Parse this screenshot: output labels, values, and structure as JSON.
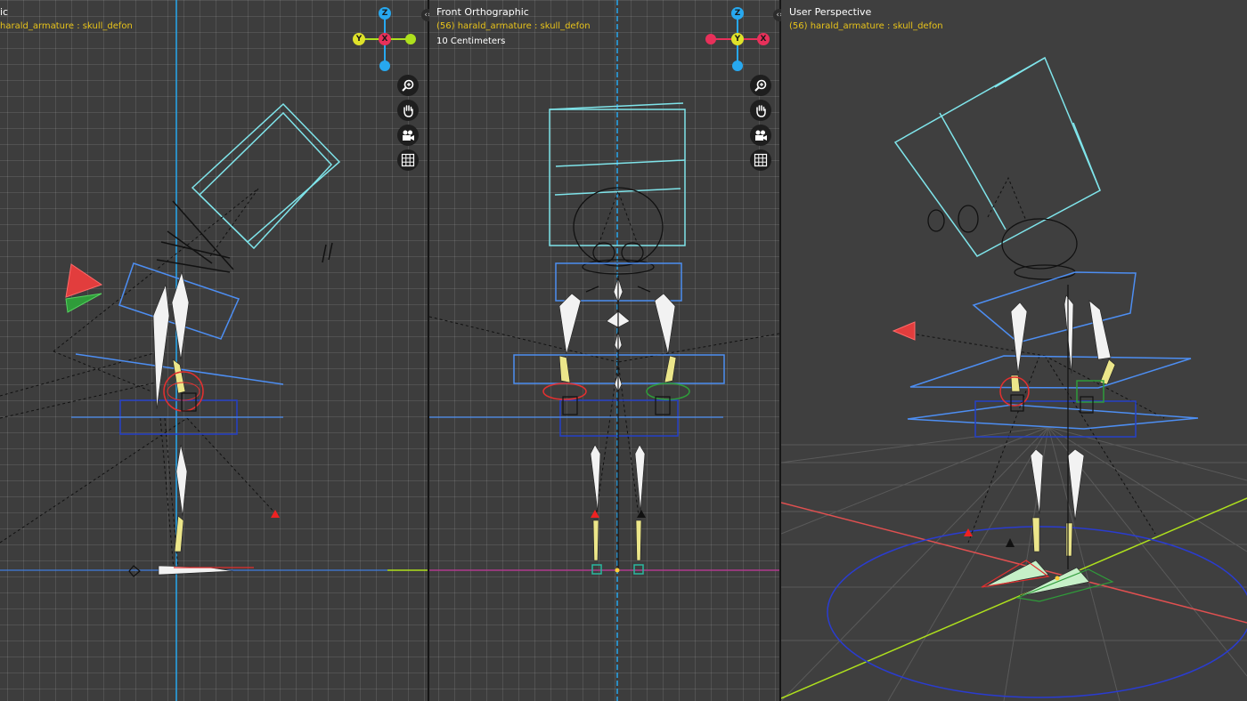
{
  "colors": {
    "axis_x": "#e8305a",
    "axis_y": "#aee01d",
    "axis_z": "#27a8ef",
    "bone": "#f2f2f2",
    "bone_selected": "#ece68a",
    "widget": "#7fe4ea",
    "header_text": "#ffffff",
    "object_text": "#e8c31a"
  },
  "viewports": {
    "left": {
      "title": "ic",
      "object": "harald_armature : skull_defon",
      "gizmo": {
        "top": "Z",
        "left": "Y",
        "center": "X"
      }
    },
    "front": {
      "title": "Front Orthographic",
      "object": "(56) harald_armature : skull_defon",
      "scale": "10 Centimeters",
      "gizmo": {
        "top": "Z",
        "center": "Y",
        "right": "X"
      }
    },
    "persp": {
      "title": "User Perspective",
      "object": "(56) harald_armature : skull_defon"
    }
  },
  "nav": {
    "zoom": "zoom-icon",
    "pan": "hand-icon",
    "camera": "camera-icon",
    "grid": "grid-icon"
  }
}
